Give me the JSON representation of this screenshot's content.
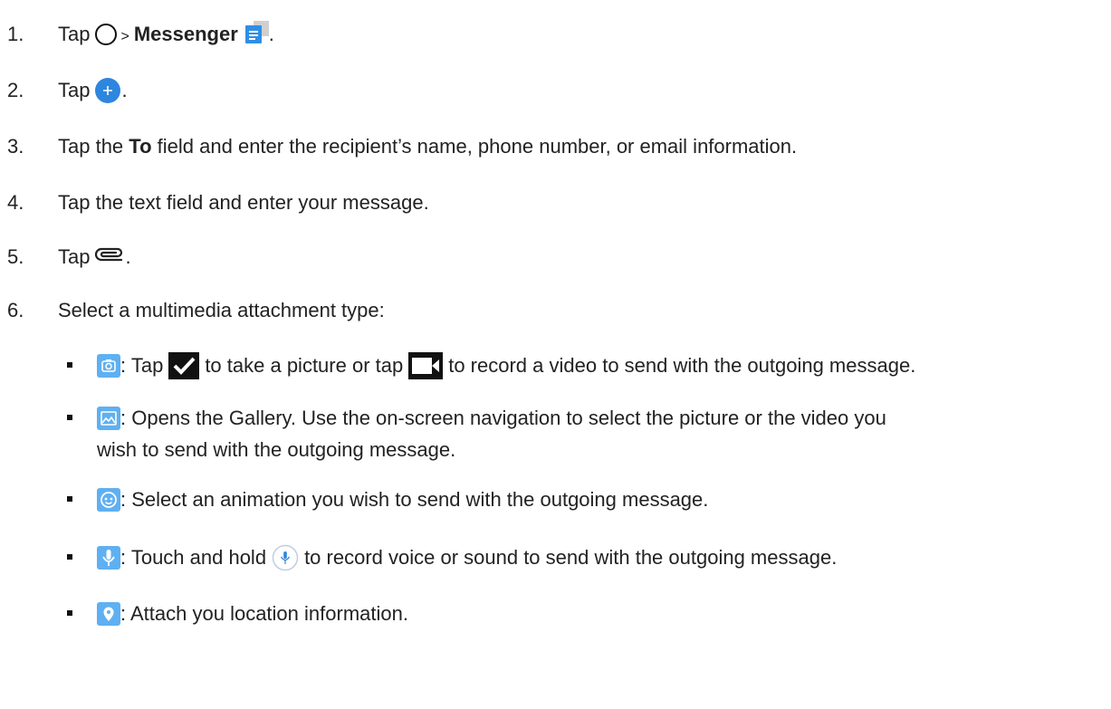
{
  "steps": [
    {
      "num": "1.",
      "pre": "Tap",
      "sep": ">",
      "bold": "Messenger",
      "post": "."
    },
    {
      "num": "2.",
      "pre": "Tap",
      "post": "."
    },
    {
      "num": "3.",
      "pre": "Tap the",
      "bold": "To",
      "post": "field and enter the recipient’s name, phone number, or email information."
    },
    {
      "num": "4.",
      "text": "Tap the text field and enter your message."
    },
    {
      "num": "5.",
      "pre": "Tap",
      "post": "."
    },
    {
      "num": "6.",
      "text": "Select a multimedia attachment type:"
    }
  ],
  "bullets": [
    {
      "icon": "camera-icon",
      "a": ": Tap",
      "b": "to take a picture or tap",
      "c": "to record a video to send with the outgoing message."
    },
    {
      "icon": "gallery-icon",
      "a": ": Opens the Gallery. Use the on-screen navigation to select the picture or the video you",
      "line2": "wish to send with the outgoing message."
    },
    {
      "icon": "sticker-icon",
      "a": ": Select an animation you wish to send with the outgoing message."
    },
    {
      "icon": "mic-icon",
      "a": ": Touch and hold",
      "b": "to record voice or sound to send with the outgoing message."
    },
    {
      "icon": "location-icon",
      "a": ": Attach you location information."
    }
  ],
  "colors": {
    "icon_blue": "#5fb0f2",
    "fab_blue": "#2e86de",
    "text": "#222222"
  }
}
